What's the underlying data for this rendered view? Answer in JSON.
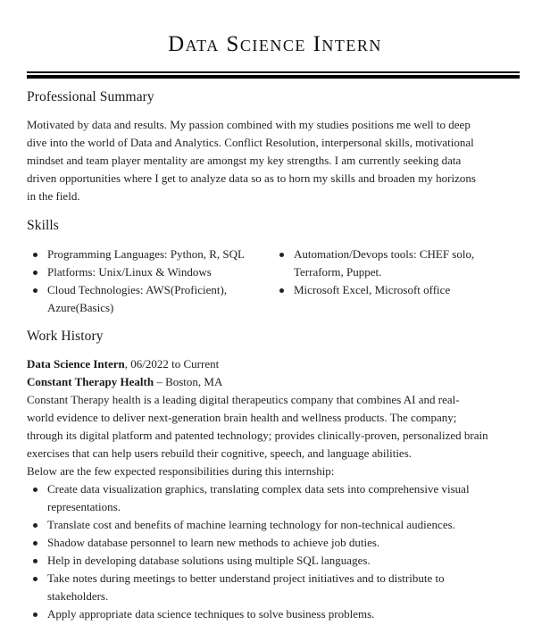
{
  "title": "Data Science Intern",
  "sections": {
    "summary": {
      "heading": "Professional Summary",
      "lines": [
        "Motivated by data and results. My passion combined with my studies positions me well to deep",
        "dive into the world of Data and Analytics. Conflict Resolution, interpersonal skills, motivational",
        "mindset and team player mentality are amongst my key strengths. I am currently seeking data",
        "driven opportunities where I get to analyze data so as to horn my skills and broaden my horizons",
        "in the field."
      ]
    },
    "skills": {
      "heading": "Skills",
      "left": [
        {
          "l1": "Programming Languages: Python, R, SQL",
          "l2": ""
        },
        {
          "l1": "Platforms: Unix/Linux & Windows",
          "l2": ""
        },
        {
          "l1": "Cloud Technologies: AWS(Proficient),",
          "l2": "Azure(Basics)"
        }
      ],
      "right": [
        {
          "l1": "Automation/Devops tools: CHEF solo,",
          "l2": "Terraform, Puppet."
        },
        {
          "l1": "Microsoft Excel, Microsoft office",
          "l2": ""
        }
      ]
    },
    "work": {
      "heading": "Work History",
      "job_title": "Data Science Intern",
      "job_dates": ", 06/2022 to Current",
      "company": "Constant Therapy Health",
      "location": " – Boston, MA",
      "description_lines": [
        "Constant Therapy health is a leading digital therapeutics company that combines AI and real-",
        "world evidence to deliver next-generation brain health and wellness products. The company;",
        "through its digital platform and patented technology; provides clinically-proven, personalized brain",
        "exercises that can help users rebuild their cognitive, speech, and language abilities.",
        "Below are the few expected responsibilities during this internship:"
      ],
      "responsibilities": [
        {
          "l1": "Create data visualization graphics, translating complex data sets into comprehensive visual",
          "l2": "representations."
        },
        {
          "l1": "Translate cost and benefits of machine learning technology for non-technical audiences.",
          "l2": ""
        },
        {
          "l1": "Shadow database personnel to learn new methods to achieve job duties.",
          "l2": ""
        },
        {
          "l1": "Help in developing database solutions using multiple SQL languages.",
          "l2": ""
        },
        {
          "l1": "Take notes during meetings to better understand project initiatives and to distribute to",
          "l2": "stakeholders."
        },
        {
          "l1": "Apply appropriate data science techniques to solve business problems.",
          "l2": ""
        }
      ]
    }
  }
}
